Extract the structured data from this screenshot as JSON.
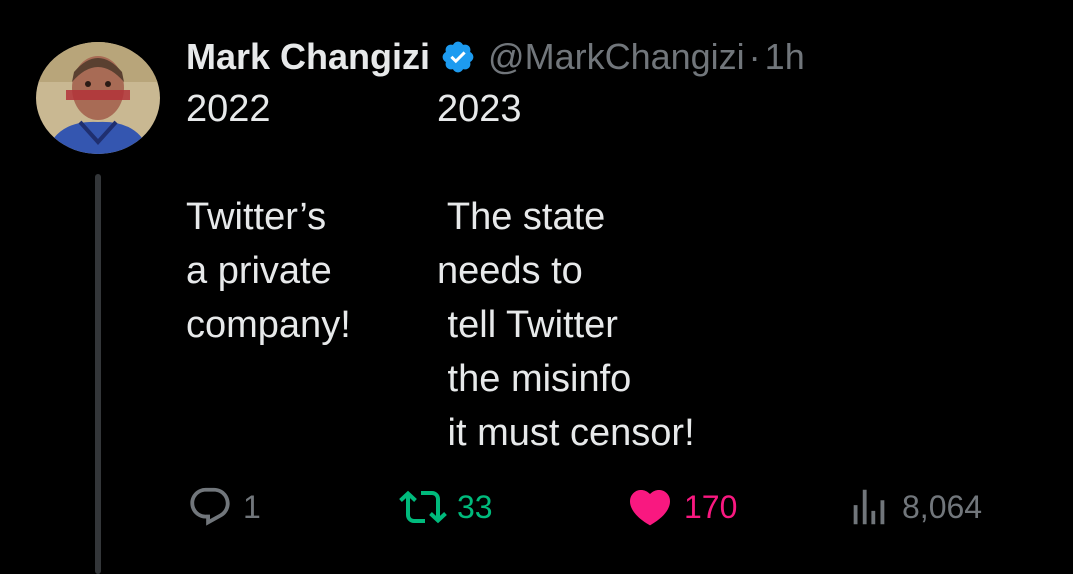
{
  "tweet": {
    "author_name": "Mark Changizi",
    "handle": "@MarkChangizi",
    "separator": "·",
    "time_ago": "1h",
    "verified_icon": "verified-badge-icon",
    "avatar_icon": "avatar-portrait-painting",
    "text_left": "2022\n\nTwitter’s\na private\ncompany!",
    "text_right": "2023\n\n The state\nneeds to\n tell Twitter\n the misinfo\n it must censor!"
  },
  "actions": {
    "reply": {
      "icon": "reply-bubble-icon",
      "count": "1"
    },
    "retweet": {
      "icon": "retweet-icon",
      "count": "33"
    },
    "like": {
      "icon": "heart-icon",
      "count": "170"
    },
    "views": {
      "icon": "views-bar-chart-icon",
      "count": "8,064"
    }
  },
  "colors": {
    "background": "#000000",
    "text_primary": "#e7e9ea",
    "text_secondary": "#71767b",
    "verified_blue": "#1d9bf0",
    "retweet_green": "#00ba7c",
    "like_pink": "#f91880",
    "thread_line": "#333639"
  }
}
